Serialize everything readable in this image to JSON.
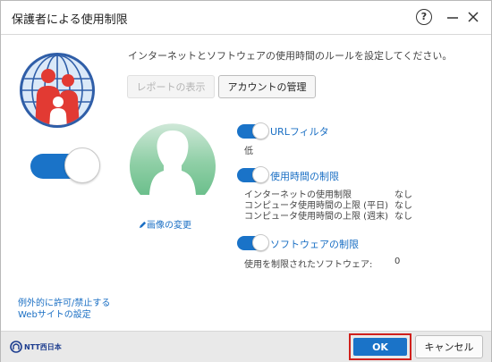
{
  "window": {
    "title": "保護者による使用制限"
  },
  "description": "インターネットとソフトウェアの使用時間のルールを設定してください。",
  "buttons": {
    "report": "レポートの表示",
    "account": "アカウントの管理",
    "ok": "OK",
    "cancel": "キャンセル"
  },
  "image_change": "画像の変更",
  "sections": {
    "url_filter": {
      "label": "URLフィルタ",
      "level": "低",
      "enabled": true
    },
    "time_limit": {
      "label": "使用時間の制限",
      "enabled": true,
      "rows": [
        {
          "name": "インターネットの使用制限",
          "value": "なし"
        },
        {
          "name": "コンピュータ使用時間の上限 (平日)",
          "value": "なし"
        },
        {
          "name": "コンピュータ使用時間の上限 (週末)",
          "value": "なし"
        }
      ]
    },
    "software_limit": {
      "label": "ソフトウェアの制限",
      "enabled": true,
      "row_name": "使用を制限されたソフトウェア:",
      "row_value": "0"
    }
  },
  "exception_link": {
    "line1": "例外的に許可/禁止する",
    "line2": "Webサイトの設定"
  },
  "footer": {
    "brand": "NTT西日本"
  },
  "colors": {
    "accent": "#1a73c8",
    "link": "#1a6fc4",
    "highlight": "#d0201c"
  },
  "main_toggle_on": true
}
